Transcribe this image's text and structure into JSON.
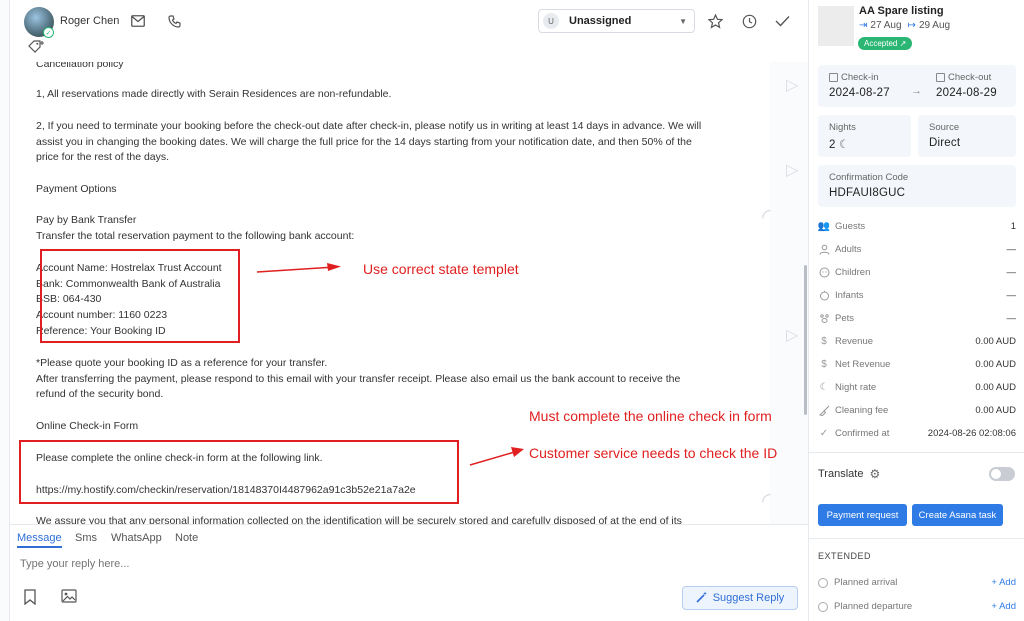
{
  "header": {
    "contact_name": "Roger Chen",
    "assignee_initial": "U",
    "assignee": "Unassigned"
  },
  "message": {
    "paragraphs": [
      "Cancellation policy",
      "1, All reservations made directly with Serain Residences are non-refundable.",
      "2, If you need to terminate your booking before the check-out date after check-in, please notify us in writing at least 14 days in advance. We will",
      "assist you in changing the booking dates. We will charge the full price for the 14 days starting from your notification date, and then 50% of the",
      "price for the rest of the days.",
      "Payment Options",
      "Pay by Bank Transfer",
      "Transfer the total reservation payment to the following bank account:",
      "Account Name: Hostrelax Trust Account",
      "Bank: Commonwealth Bank of Australia",
      "BSB: 064-430",
      "Account number: 1160 0223",
      "Reference: Your Booking ID",
      "*Please quote your booking ID as a reference for your transfer.",
      "After transferring the payment, please respond to this email with your transfer receipt. Please also email us the bank account to receive the",
      "refund of the security bond.",
      "Online Check-in Form",
      "Please complete the online check-in form at the following link.",
      "https://my.hostify.com/checkin/reservation/18148370I4487962a91c3b52e21a7a2e",
      "We assure you that any personal information collected on the identification will be securely stored and carefully disposed of at the end of its"
    ]
  },
  "annotations": {
    "note1": "Use correct state templet",
    "note2": "Must complete the online check in form",
    "note3": "Customer service needs to check the ID",
    "color": "#e02020"
  },
  "composer": {
    "tabs": [
      "Message",
      "Sms",
      "WhatsApp",
      "Note"
    ],
    "active_tab": "Message",
    "placeholder": "Type your reply here...",
    "suggest_label": "Suggest Reply"
  },
  "sidebar": {
    "listing_title": "AA Spare listing",
    "checkin_short": "27 Aug",
    "checkout_short": "29 Aug",
    "status": "Accepted ↗",
    "checkin_label": "Check-in",
    "checkin_date": "2024-08-27",
    "checkout_label": "Check-out",
    "checkout_date": "2024-08-29",
    "nights_label": "Nights",
    "nights_value": "2",
    "source_label": "Source",
    "source_value": "Direct",
    "confirmation_label": "Confirmation Code",
    "confirmation_value": "HDFAUI8GUC",
    "stats": [
      {
        "label": "Guests",
        "value": "1",
        "icon": "guests-icon"
      },
      {
        "label": "Adults",
        "value": "—",
        "icon": "person-icon"
      },
      {
        "label": "Children",
        "value": "—",
        "icon": "child-icon"
      },
      {
        "label": "Infants",
        "value": "—",
        "icon": "infant-icon"
      },
      {
        "label": "Pets",
        "value": "—",
        "icon": "paw-icon"
      },
      {
        "label": "Revenue",
        "value": "0.00 AUD",
        "icon": "dollar-icon"
      },
      {
        "label": "Net Revenue",
        "value": "0.00 AUD",
        "icon": "dollar-icon"
      },
      {
        "label": "Night rate",
        "value": "0.00 AUD",
        "icon": "moon-icon"
      },
      {
        "label": "Cleaning fee",
        "value": "0.00 AUD",
        "icon": "broom-icon"
      },
      {
        "label": "Confirmed at",
        "value": "2024-08-26 02:08:06",
        "icon": "check-icon"
      }
    ],
    "translate_label": "Translate",
    "payment_request_label": "Payment request",
    "asana_label": "Create Asana task",
    "extended_label": "EXTENDED",
    "planned_arrival": "Planned arrival",
    "planned_departure": "Planned departure",
    "add_label": "+ Add"
  }
}
